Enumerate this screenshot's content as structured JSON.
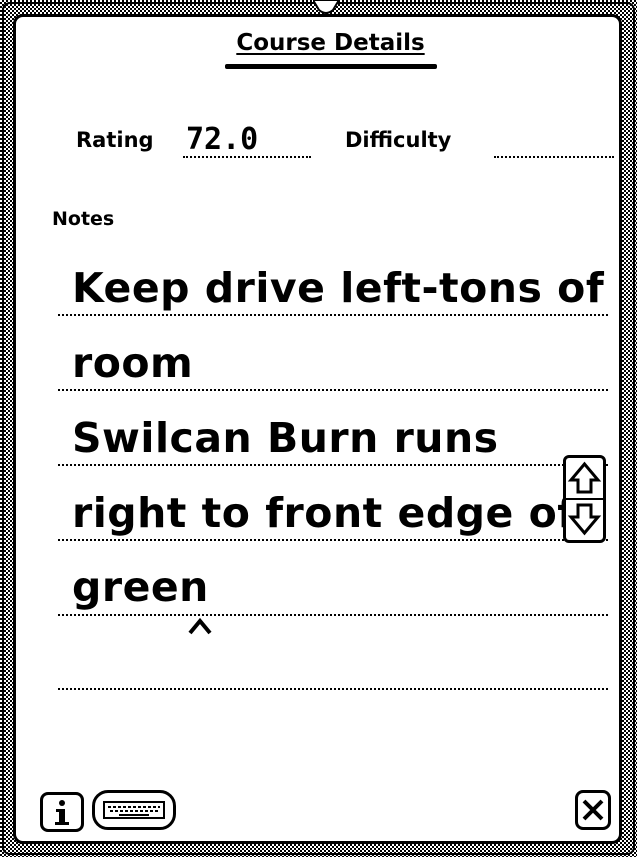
{
  "window": {
    "title": "Course Details"
  },
  "fields": {
    "rating_label": "Rating",
    "rating_value": "72.0",
    "difficulty_label": "Difficulty",
    "difficulty_value": ""
  },
  "notes": {
    "label": "Notes",
    "lines": [
      "Keep drive left-tons of",
      "room",
      "Swilcan Burn runs",
      "right to front edge of",
      "green",
      ""
    ]
  },
  "icons": {
    "info": "info-icon",
    "keyboard": "keyboard-icon",
    "close": "close-icon",
    "scroll_up": "scroll-up-arrow-icon",
    "scroll_down": "scroll-down-arrow-icon"
  }
}
